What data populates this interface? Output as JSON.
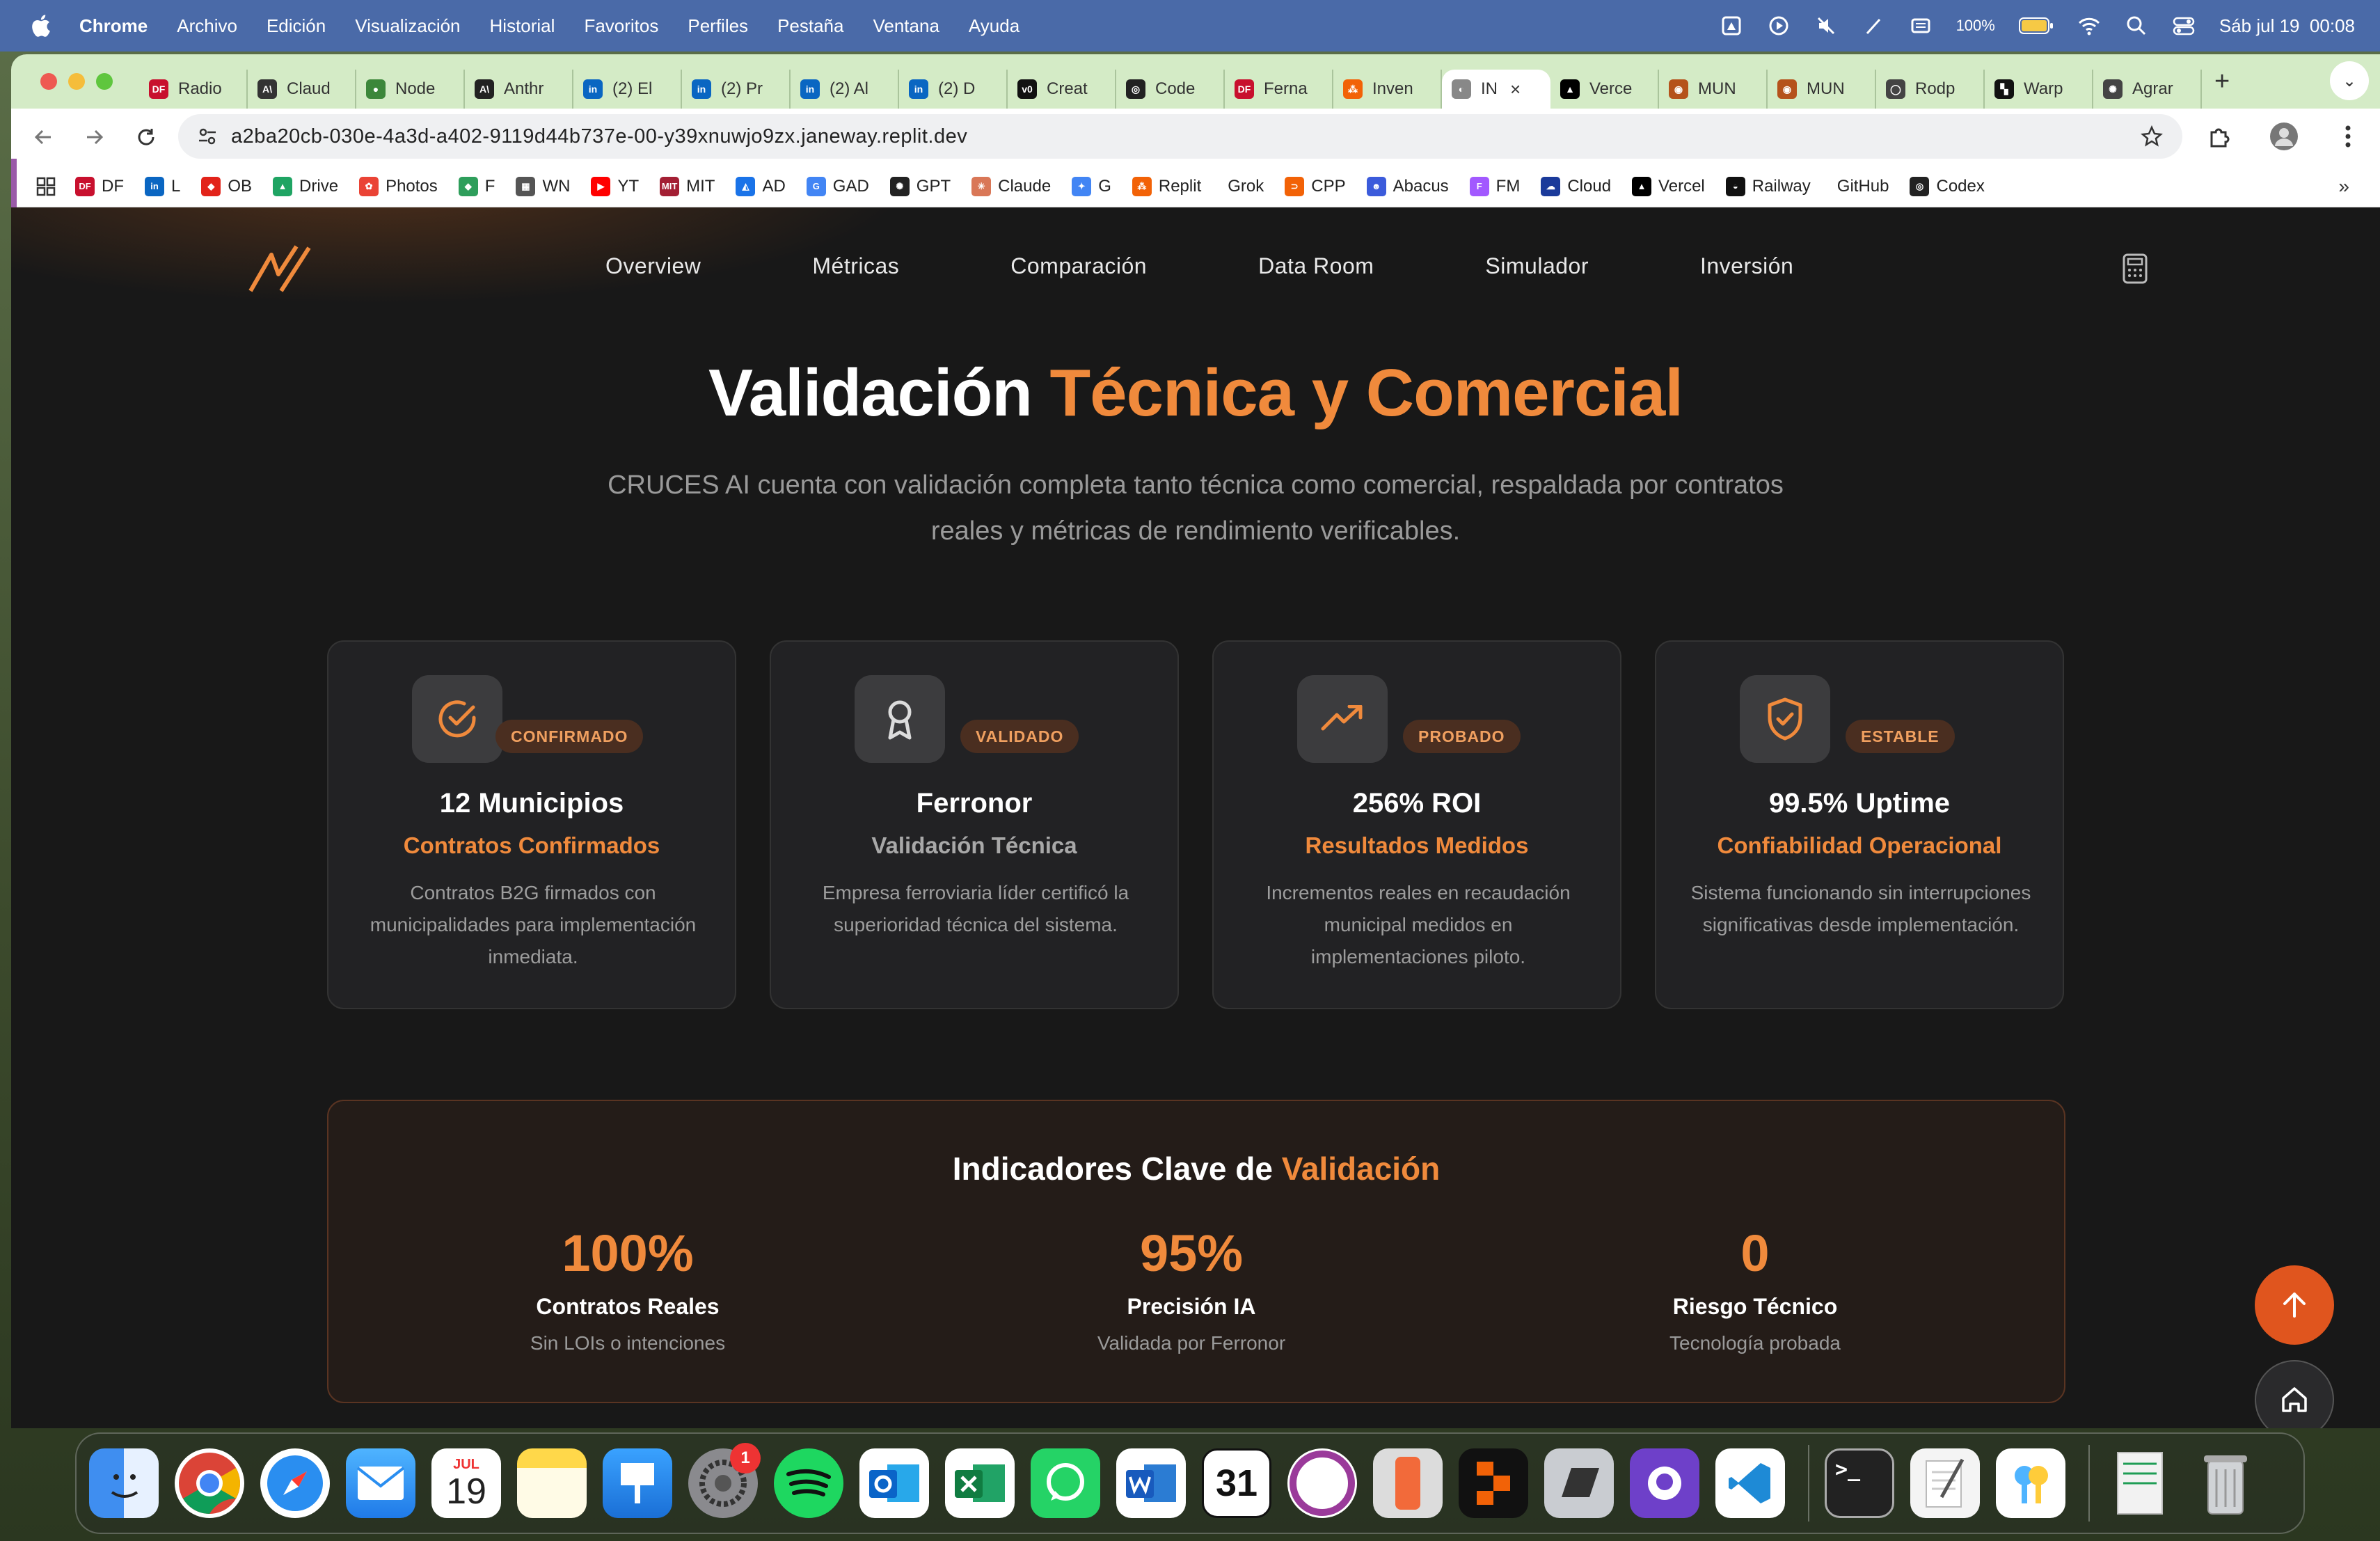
{
  "menubar": {
    "app": "Chrome",
    "items": [
      "Archivo",
      "Edición",
      "Visualización",
      "Historial",
      "Favoritos",
      "Perfiles",
      "Pestaña",
      "Ventana",
      "Ayuda"
    ],
    "battery": "100%",
    "datetime": "Sáb jul 19  00:08"
  },
  "tabs": [
    {
      "title": "Radio",
      "color": "#c8102e",
      "glyph": "DF"
    },
    {
      "title": "Claud",
      "color": "#333333",
      "glyph": "A\\"
    },
    {
      "title": "Node",
      "color": "#3c873a",
      "glyph": "●"
    },
    {
      "title": "Anthr",
      "color": "#222222",
      "glyph": "A\\"
    },
    {
      "title": "(2) El",
      "color": "#0a66c2",
      "glyph": "in"
    },
    {
      "title": "(2) Pr",
      "color": "#0a66c2",
      "glyph": "in"
    },
    {
      "title": "(2) Al",
      "color": "#0a66c2",
      "glyph": "in"
    },
    {
      "title": "(2) D",
      "color": "#0a66c2",
      "glyph": "in"
    },
    {
      "title": "Creat",
      "color": "#111111",
      "glyph": "v0"
    },
    {
      "title": "Code",
      "color": "#222222",
      "glyph": "◎"
    },
    {
      "title": "Ferna",
      "color": "#c8102e",
      "glyph": "DF"
    },
    {
      "title": "Inven",
      "color": "#f26207",
      "glyph": "⁂"
    },
    {
      "title": "IN",
      "color": "#888888",
      "glyph": "◐",
      "active": true
    },
    {
      "title": "Verce",
      "color": "#000000",
      "glyph": "▲"
    },
    {
      "title": "MUN",
      "color": "#b5521b",
      "glyph": "◉"
    },
    {
      "title": "MUN",
      "color": "#b5521b",
      "glyph": "◉"
    },
    {
      "title": "Rodp",
      "color": "#444444",
      "glyph": "◯"
    },
    {
      "title": "Warp",
      "color": "#111111",
      "glyph": "▚"
    },
    {
      "title": "Agrar",
      "color": "#444444",
      "glyph": "✺"
    }
  ],
  "address": {
    "url": "a2ba20cb-030e-4a3d-a402-9119d44b737e-00-y39xnuwjo9zx.janeway.replit.dev"
  },
  "bookmarks": [
    {
      "label": "DF",
      "color": "#c8102e",
      "glyph": "DF"
    },
    {
      "label": "L",
      "color": "#0a66c2",
      "glyph": "in"
    },
    {
      "label": "OB",
      "color": "#e2231a",
      "glyph": "◆"
    },
    {
      "label": "Drive",
      "color": "#1fa463",
      "glyph": "▲"
    },
    {
      "label": "Photos",
      "color": "#ea4335",
      "glyph": "✿"
    },
    {
      "label": "F",
      "color": "#2e9e5b",
      "glyph": "◆"
    },
    {
      "label": "WN",
      "color": "#555555",
      "glyph": "▦"
    },
    {
      "label": "YT",
      "color": "#ff0000",
      "glyph": "▶"
    },
    {
      "label": "MIT",
      "color": "#a31f34",
      "glyph": "MIT"
    },
    {
      "label": "AD",
      "color": "#1a73e8",
      "glyph": "◭"
    },
    {
      "label": "GAD",
      "color": "#4285f4",
      "glyph": "G"
    },
    {
      "label": "GPT",
      "color": "#222222",
      "glyph": "✺"
    },
    {
      "label": "Claude",
      "color": "#d97757",
      "glyph": "✳"
    },
    {
      "label": "G",
      "color": "#4285f4",
      "glyph": "✦"
    },
    {
      "label": "Replit",
      "color": "#f26207",
      "glyph": "⁂"
    },
    {
      "label": "Grok",
      "color": "#ffffff",
      "glyph": ""
    },
    {
      "label": "CPP",
      "color": "#f26207",
      "glyph": "⊃"
    },
    {
      "label": "Abacus",
      "color": "#3b5bdb",
      "glyph": "☻"
    },
    {
      "label": "FM",
      "color": "#a259ff",
      "glyph": "F"
    },
    {
      "label": "Cloud",
      "color": "#1a3a9a",
      "glyph": "☁"
    },
    {
      "label": "Vercel",
      "color": "#000000",
      "glyph": "▲"
    },
    {
      "label": "Railway",
      "color": "#111111",
      "glyph": "◒"
    },
    {
      "label": "GitHub",
      "color": "#ffffff",
      "glyph": ""
    },
    {
      "label": "Codex",
      "color": "#222222",
      "glyph": "◎"
    }
  ],
  "site": {
    "nav": [
      "Overview",
      "Métricas",
      "Comparación",
      "Data Room",
      "Simulador",
      "Inversión"
    ],
    "title_white": "Validación ",
    "title_accent": "Técnica y Comercial",
    "subtitle": "CRUCES AI cuenta con validación completa tanto técnica como comercial, respaldada por contratos reales y métricas de rendimiento verificables.",
    "accent_color": "#f08a3c",
    "cards": [
      {
        "icon": "check-circle-icon",
        "badge": "CONFIRMADO",
        "title": "12 Municipios",
        "subtitle": "Contratos Confirmados",
        "subtitle_accent": true,
        "desc": "Contratos B2G firmados con municipalidades para implementación inmediata."
      },
      {
        "icon": "award-icon",
        "badge": "VALIDADO",
        "title": "Ferronor",
        "subtitle": "Validación Técnica",
        "subtitle_accent": false,
        "desc": "Empresa ferroviaria líder certificó la superioridad técnica del sistema."
      },
      {
        "icon": "trending-up-icon",
        "badge": "PROBADO",
        "title": "256% ROI",
        "subtitle": "Resultados Medidos",
        "subtitle_accent": true,
        "desc": "Incrementos reales en recaudación municipal medidos en implementaciones piloto."
      },
      {
        "icon": "shield-check-icon",
        "badge": "ESTABLE",
        "title": "99.5% Uptime",
        "subtitle": "Confiabilidad Operacional",
        "subtitle_accent": true,
        "desc": "Sistema funcionando sin interrupciones significativas desde implementación."
      }
    ],
    "indicators": {
      "title_white": "Indicadores Clave de ",
      "title_accent": "Validación",
      "items": [
        {
          "value": "100%",
          "label": "Contratos Reales",
          "desc": "Sin LOIs o intenciones"
        },
        {
          "value": "95%",
          "label": "Precisión IA",
          "desc": "Validada por Ferronor"
        },
        {
          "value": "0",
          "label": "Riesgo Técnico",
          "desc": "Tecnología probada"
        }
      ]
    }
  },
  "dock": {
    "calendar_month": "JUL",
    "calendar_day": "19",
    "settings_badge": "1",
    "apps": [
      "finder-icon",
      "chrome-icon",
      "safari-icon",
      "mail-icon",
      "calendar-icon",
      "notes-icon",
      "keynote-icon",
      "system-settings-icon",
      "spotify-icon",
      "outlook-icon",
      "excel-icon",
      "whatsapp-icon",
      "word-icon",
      "fantastical-icon",
      "screen-recorder-icon",
      "iphone-mirroring-icon",
      "replit-icon",
      "parallels-icon",
      "github-desktop-icon",
      "vscode-icon",
      "terminal-icon",
      "textedit-icon",
      "passwords-icon",
      "xlsx-file-icon",
      "trash-icon"
    ]
  }
}
